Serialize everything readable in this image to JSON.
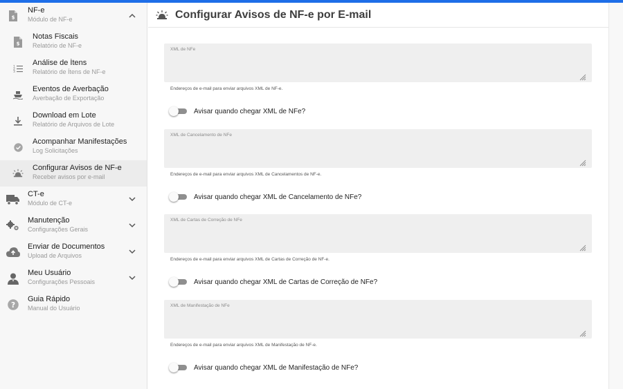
{
  "header": {
    "title": "Configurar Avisos de NF-e por E-mail",
    "icon": "bell-ring-icon"
  },
  "sidebar": {
    "items": [
      {
        "name": "nfe-module",
        "level": "top",
        "title": "NF-e",
        "subtitle": "Módulo de NF-e",
        "icon": "invoice-icon",
        "chevron": "up",
        "active": false
      },
      {
        "name": "notas-fiscais",
        "level": "sub",
        "title": "Notas Fiscais",
        "subtitle": "Relatório de NF-e",
        "icon": "invoice-icon",
        "active": false
      },
      {
        "name": "analise-itens",
        "level": "sub",
        "title": "Análise de Ítens",
        "subtitle": "Relatório de Ítens de NF-e",
        "icon": "numbered-list-icon",
        "active": false
      },
      {
        "name": "eventos-averbacao",
        "level": "sub",
        "title": "Eventos de Averbação",
        "subtitle": "Averbação de Exportação",
        "icon": "ship-icon",
        "active": false
      },
      {
        "name": "download-lote",
        "level": "sub",
        "title": "Download em Lote",
        "subtitle": "Relatório de Arquivos de Lote",
        "icon": "download-icon",
        "active": false
      },
      {
        "name": "acompanhar-manifestacoes",
        "level": "sub",
        "title": "Acompanhar Manifestações",
        "subtitle": "Log Solicitações",
        "icon": "check-circle-icon",
        "active": false
      },
      {
        "name": "configurar-avisos",
        "level": "sub",
        "title": "Configurar Avisos de NF-e",
        "subtitle": "Receber avisos por e-mail",
        "icon": "bell-ring-icon",
        "active": true
      },
      {
        "name": "cte-module",
        "level": "top",
        "title": "CT-e",
        "subtitle": "Módulo de CT-e",
        "icon": "truck-icon",
        "chevron": "down",
        "active": false
      },
      {
        "name": "manutencao",
        "level": "top",
        "title": "Manutenção",
        "subtitle": "Configurações Gerais",
        "icon": "gears-icon",
        "chevron": "down",
        "active": false
      },
      {
        "name": "enviar-documentos",
        "level": "top",
        "title": "Enviar de Documentos",
        "subtitle": "Upload de Arquivos",
        "icon": "cloud-upload-icon",
        "chevron": "down",
        "active": false
      },
      {
        "name": "meu-usuario",
        "level": "top",
        "title": "Meu Usuário",
        "subtitle": "Configurações Pessoais",
        "icon": "user-icon",
        "chevron": "down",
        "active": false
      },
      {
        "name": "guia-rapido",
        "level": "top",
        "title": "Guia Rápido",
        "subtitle": "Manual do Usuário",
        "icon": "help-icon",
        "active": false
      }
    ]
  },
  "sections": [
    {
      "name": "xml-nfe",
      "field_label": "XML de NFe",
      "helper": "Endereços de e-mail para enviar arquivos XML de NF-e.",
      "toggle_label": "Avisar quando chegar XML de NFe?",
      "toggle_on": false
    },
    {
      "name": "xml-cancelamento",
      "field_label": "XML de Cancelamento de NFe",
      "helper": "Endereços de e-mail para enviar arquivos XML de Cancelamentos de NF-e.",
      "toggle_label": "Avisar quando chegar XML de Cancelamento de NFe?",
      "toggle_on": false
    },
    {
      "name": "xml-cartas-correcao",
      "field_label": "XML de Cartas de Correção de NFe",
      "helper": "Endereços de e-mail para enviar arquivos XML de Cartas de Correção de NF-e.",
      "toggle_label": "Avisar quando chegar XML de Cartas de Correção de NFe?",
      "toggle_on": false
    },
    {
      "name": "xml-manifestacao",
      "field_label": "XML de Manifestação de NFe",
      "helper": "Endereços de e-mail para enviar arquivos XML de Manifestação de NF-e.",
      "toggle_label": "Avisar quando chegar XML de Manifestação de NFe?",
      "toggle_on": false
    }
  ],
  "colors": {
    "accent": "#1e6ee8",
    "field_bg": "#efefef",
    "toggle_track": "#8f8f8f"
  }
}
